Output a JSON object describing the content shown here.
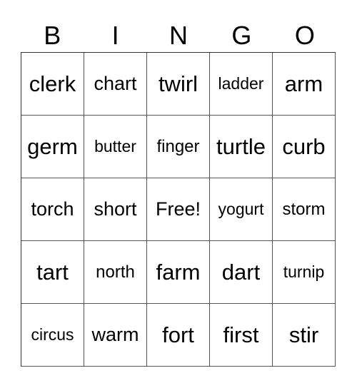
{
  "header": [
    "B",
    "I",
    "N",
    "G",
    "O"
  ],
  "rows": [
    [
      "clerk",
      "chart",
      "twirl",
      "ladder",
      "arm"
    ],
    [
      "germ",
      "butter",
      "finger",
      "turtle",
      "curb"
    ],
    [
      "torch",
      "short",
      "Free!",
      "yogurt",
      "storm"
    ],
    [
      "tart",
      "north",
      "farm",
      "dart",
      "turnip"
    ],
    [
      "circus",
      "warm",
      "fort",
      "first",
      "stir"
    ]
  ]
}
